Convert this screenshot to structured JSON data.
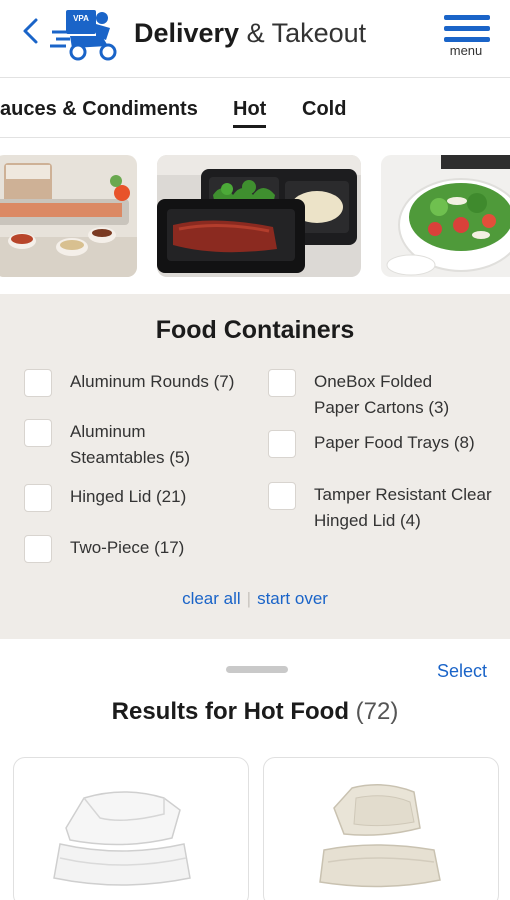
{
  "header": {
    "title_bold": "Delivery",
    "title_rest": " & Takeout",
    "menu_label": "menu",
    "logo_text": "VPA"
  },
  "tabs": [
    {
      "label": "auces & Condiments",
      "active": false
    },
    {
      "label": "Hot",
      "active": true
    },
    {
      "label": "Cold",
      "active": false
    }
  ],
  "carousel": {
    "icons": [
      "sauce-containers-photo",
      "meal-tray-photo",
      "salad-bowl-photo"
    ]
  },
  "filters": {
    "title": "Food Containers",
    "options": [
      {
        "label": "Aluminum Rounds (7)"
      },
      {
        "label": "Aluminum Steamtables (5)"
      },
      {
        "label": "Hinged Lid (21)"
      },
      {
        "label": "Two-Piece (17)"
      },
      {
        "label": "OneBox Folded Paper Cartons (3)"
      },
      {
        "label": "Paper Food Trays (8)"
      },
      {
        "label": "Tamper Resistant Clear Hinged Lid (4)"
      }
    ],
    "clear_all": "clear all",
    "separator": "|",
    "start_over": "start over"
  },
  "results": {
    "select_label": "Select",
    "title": "Results for Hot Food",
    "count": "(72)"
  },
  "colors": {
    "accent": "#1a64c8",
    "panel_bg": "#efece8"
  }
}
